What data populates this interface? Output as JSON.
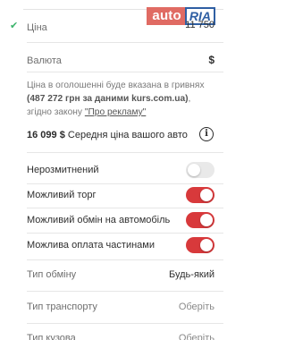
{
  "brand": {
    "part1": "auto",
    "part2": "RIA"
  },
  "price": {
    "label": "Ціна",
    "value": "11 750"
  },
  "currency": {
    "label": "Валюта",
    "symbol": "$"
  },
  "info": {
    "line_start": "Ціна в оголошенні буде вказана в гривнях",
    "amount": "(487 272 грн за даними kurs.com.ua)",
    "after_amount": ", згідно закону ",
    "law_link": "\"Про рекламу\""
  },
  "average": {
    "amount": "16 099 $",
    "text": "Середня ціна вашого авто"
  },
  "options": [
    {
      "label": "Нерозмитнений",
      "state": "off"
    },
    {
      "label": "Можливий торг",
      "state": "on"
    },
    {
      "label": "Можливий обмін на автомобіль",
      "state": "on"
    },
    {
      "label": "Можлива оплата частинами",
      "state": "on"
    }
  ],
  "selects": [
    {
      "label": "Тип обміну",
      "value": "Будь-який"
    },
    {
      "label": "Тип транспорту",
      "value": "Оберіть"
    },
    {
      "label": "Тип кузова",
      "value": "Оберіть"
    }
  ],
  "colors": {
    "accent": "#d8393b",
    "check": "#3bb36b"
  }
}
